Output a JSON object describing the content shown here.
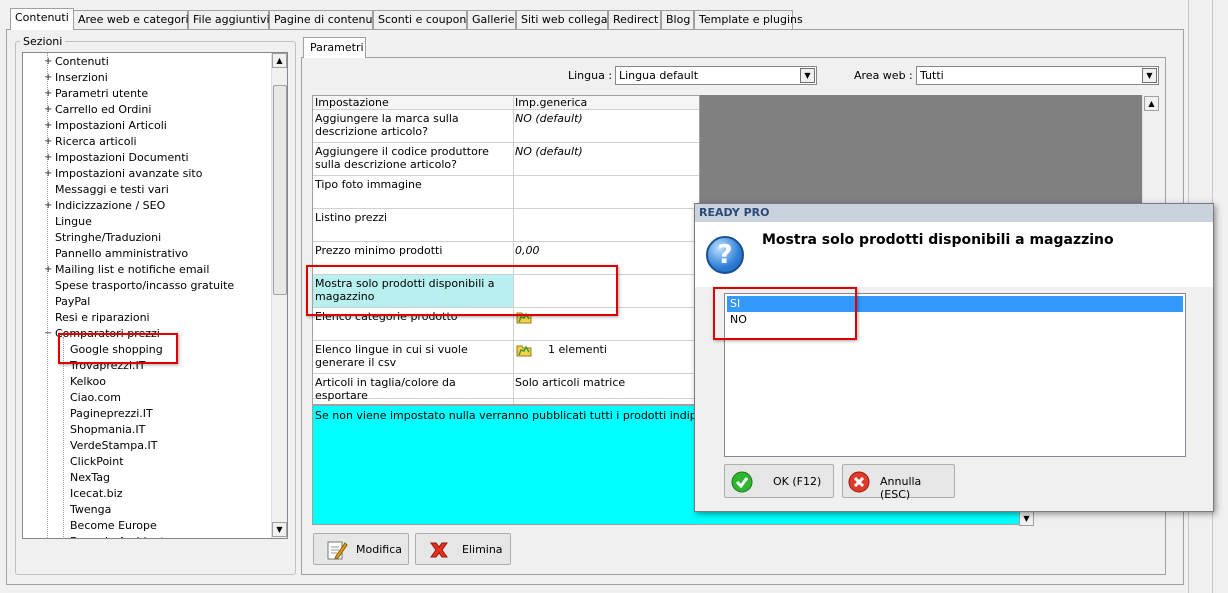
{
  "tabs": [
    "Contenuti",
    "Aree web e categorie",
    "File aggiuntivi",
    "Pagine di contenuti",
    "Sconti e coupon",
    "Gallerie",
    "Siti web collegati",
    "Redirect",
    "Blog",
    "Template e plugins"
  ],
  "sezioni": {
    "label": "Sezioni",
    "items": [
      "Contenuti",
      "Inserzioni",
      "Parametri utente",
      "Carrello ed Ordini",
      "Impostazioni Articoli",
      "Ricerca articoli",
      "Impostazioni Documenti",
      "Impostazioni avanzate sito",
      "Messaggi e testi vari",
      "Indicizzazione / SEO",
      "Lingue",
      "Stringhe/Traduzioni",
      "Pannello amministrativo",
      "Mailing list e notifiche email",
      "Spese trasporto/incasso gratuite",
      "PayPal",
      "Resi e riparazioni",
      "Comparatori prezzi"
    ],
    "subitems": [
      "Google shopping",
      "Trovaprezzi.IT",
      "Kelkoo",
      "Ciao.com",
      "Pagineprezzi.IT",
      "Shopmania.IT",
      "VerdeStampa.IT",
      "ClickPoint",
      "NexTag",
      "Icecat.biz",
      "Twenga",
      "Become Europe",
      "Bengala Ambiente"
    ]
  },
  "parametri": {
    "tab": "Parametri",
    "lingua_label": "Lingua :",
    "lingua_value": "Lingua default",
    "area_label": "Area web :",
    "area_value": "Tutti",
    "headers": [
      "Impostazione",
      "Imp.generica"
    ],
    "rows": [
      {
        "name": "Aggiungere la marca sulla descrizione articolo?",
        "value": "NO (default)"
      },
      {
        "name": "Aggiungere il codice produttore sulla descrizione articolo?",
        "value": "NO (default)"
      },
      {
        "name": "Tipo foto immagine",
        "value": ""
      },
      {
        "name": "Listino prezzi",
        "value": ""
      },
      {
        "name": "Prezzo minimo prodotti",
        "value": "0,00"
      },
      {
        "name": "Mostra solo prodotti disponibili a magazzino",
        "value": ""
      },
      {
        "name": "Elenco categorie prodotto",
        "value": ""
      },
      {
        "name": "Elenco lingue in cui si vuole generare il csv",
        "value": "1 elementi"
      },
      {
        "name": "Articoli in taglia/colore da esportare",
        "value": "Solo articoli matrice"
      }
    ],
    "description": "Se non viene impostato nulla verranno pubblicati tutti i prodotti indipendentemente",
    "modifica": "Modifica",
    "elimina": "Elimina"
  },
  "dialog": {
    "title": "READY PRO",
    "message": "Mostra solo prodotti disponibili a magazzino",
    "options": [
      "SI",
      "NO"
    ],
    "ok": "OK (F12)",
    "annulla": "Annulla (ESC)"
  }
}
